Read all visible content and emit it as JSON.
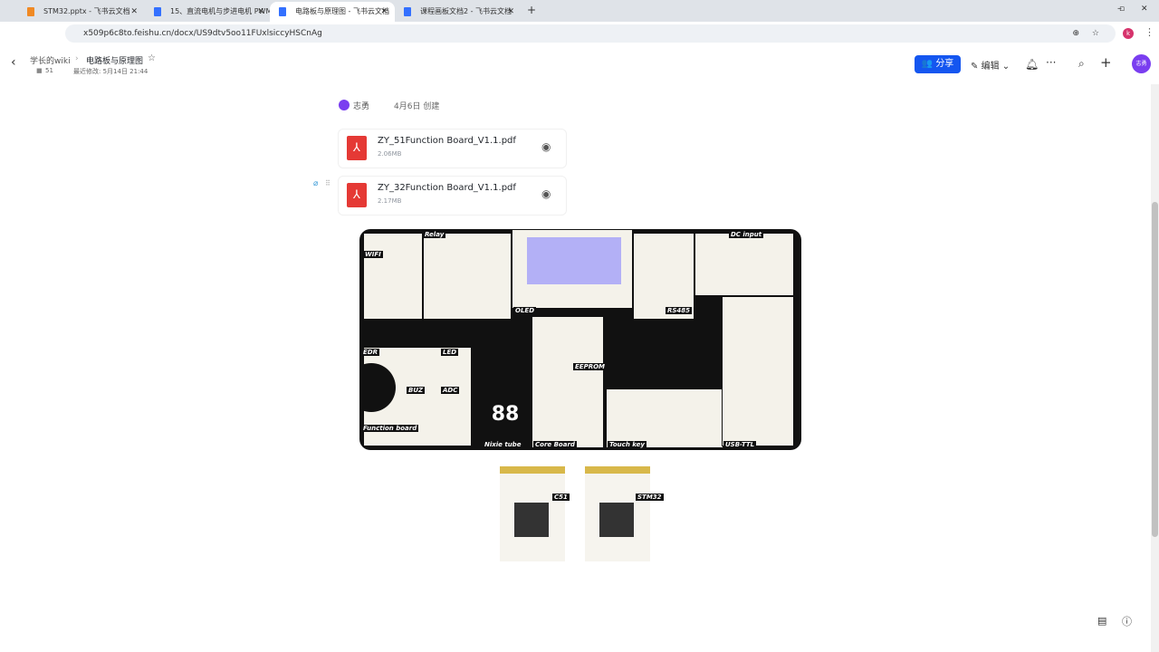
{
  "browser": {
    "tabs": [
      {
        "title": "STM32.pptx - 飞书云文档",
        "color": "#f08a24"
      },
      {
        "title": "15、直流电机与步进电机 PWM",
        "color": "#3370ff"
      },
      {
        "title": "电路板与原理图 - 飞书云文档",
        "color": "#3370ff",
        "active": true
      },
      {
        "title": "课程画板文档2 - 飞书云文档",
        "color": "#3370ff"
      }
    ],
    "url": "x509p6c8to.feishu.cn/docx/US9dtv5oo11FUxlsiccyHSCnAg",
    "profile_initial": "k"
  },
  "header": {
    "breadcrumb_root": "学长的wiki",
    "breadcrumb_current": "电路板与原理图",
    "count": "51",
    "last_modified": "最近修改: 5月14日 21:44",
    "share_label": "分享",
    "edit_label": "编辑",
    "avatar_text": "志勇"
  },
  "doc": {
    "author": "志勇",
    "created": "4月6日 创建",
    "files": [
      {
        "name": "ZY_51Function Board_V1.1.pdf",
        "size": "2.06MB"
      },
      {
        "name": "ZY_32Function Board_V1.1.pdf",
        "size": "2.17MB"
      }
    ],
    "board_labels": [
      "WIFI",
      "Relay",
      "OLED",
      "RS485",
      "DC input",
      "EDR",
      "LED",
      "BUZ",
      "ADC",
      "Nixie tube",
      "Core Board",
      "Touch key",
      "USB-TTL",
      "Function board",
      "EEPROM"
    ],
    "module_labels": [
      "C51",
      "STM32"
    ]
  }
}
